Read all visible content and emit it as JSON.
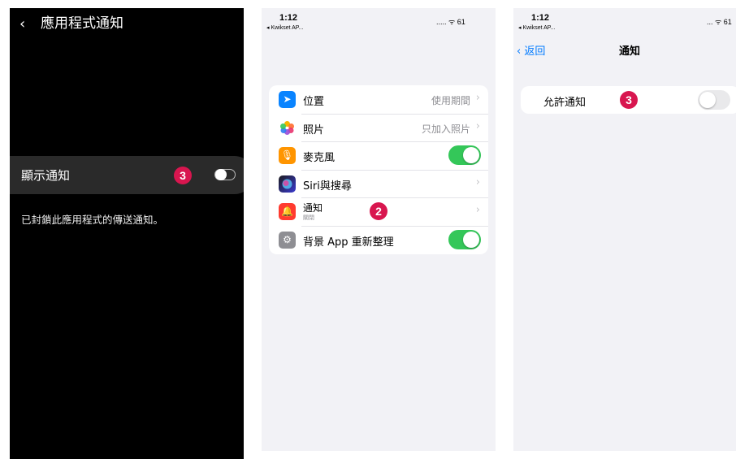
{
  "android": {
    "back_icon": "‹",
    "title": "應用程式通知",
    "row_label": "顯示通知",
    "badge": "3",
    "toggle_state": "off",
    "note": "已封鎖此應用程式的傳送通知。"
  },
  "ios_settings": {
    "status": {
      "time": "1:12",
      "back_app": "◂ Kwikset AP...",
      "right": "..... ᯤ 61"
    },
    "items": [
      {
        "label": "位置",
        "value": "使用期間",
        "icon": "location-arrow-icon",
        "icon_color": "#0a84ff"
      },
      {
        "label": "照片",
        "value": "只加入照片",
        "icon": "photos-icon",
        "icon_color": "#ffffff"
      },
      {
        "label": "麥克風",
        "toggle": "on",
        "icon": "microphone-icon",
        "icon_color": "#ff9500"
      },
      {
        "label": "Siri與搜尋",
        "icon": "siri-icon",
        "icon_color": "#1c1c1e"
      },
      {
        "label": "通知",
        "sub": "關閉",
        "icon": "notification-bell-icon",
        "icon_color": "#ff3b30",
        "badge": "2"
      },
      {
        "label": "背景 App 重新整理",
        "toggle": "on",
        "icon": "gear-icon",
        "icon_color": "#8e8e93"
      }
    ],
    "chevron": "›"
  },
  "ios_notifications": {
    "status": {
      "time": "1:12",
      "back_app": "◂ Kwikset AP...",
      "right": "... ᯤ 61"
    },
    "nav_back": "‹ 返回",
    "nav_title": "通知",
    "row_label": "允許通知",
    "badge": "3",
    "toggle_state": "off"
  },
  "colors": {
    "badge": "#d8164f",
    "ios_green": "#34c759",
    "ios_blue": "#007aff"
  }
}
